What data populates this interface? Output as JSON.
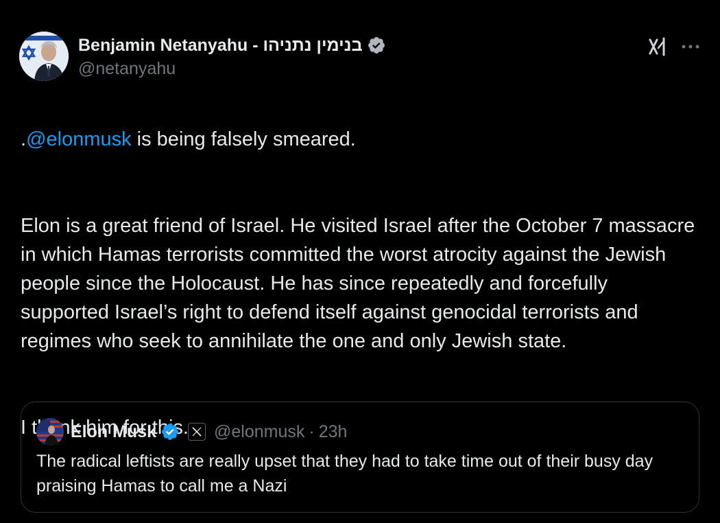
{
  "author": {
    "display_name": "Benjamin Netanyahu - בנימין נתניהו",
    "handle": "@netanyahu",
    "verified": true,
    "avatar_icon": "profile-photo"
  },
  "actions": {
    "grok_icon": "grok-icon",
    "more_icon": "more-options-icon"
  },
  "tweet": {
    "line1_prefix": ".",
    "line1_mention": "@elonmusk",
    "line1_rest": " is being falsely smeared.",
    "paragraph2": "Elon is a great friend of Israel.  He visited Israel after the October 7 massacre in which Hamas terrorists committed the worst atrocity against the Jewish people since the Holocaust. He has since repeatedly and forcefully supported Israel’s right to defend itself against genocidal terrorists and regimes who seek to annihilate the one and only Jewish state.",
    "paragraph3": "I thank him for this."
  },
  "quote": {
    "display_name": "Elon Musk",
    "verified": true,
    "affiliate_badge": "x-logo-icon",
    "handle": "@elonmusk",
    "separator": "·",
    "time": "23h",
    "text": "The radical leftists are really upset that they had to take time out of their busy day praising Hamas to call me a Nazi"
  },
  "colors": {
    "background": "#000000",
    "text": "#e7e9ea",
    "muted": "#71767b",
    "link": "#1d9bf0",
    "verified": "#1d9bf0",
    "border": "#2f3336"
  }
}
